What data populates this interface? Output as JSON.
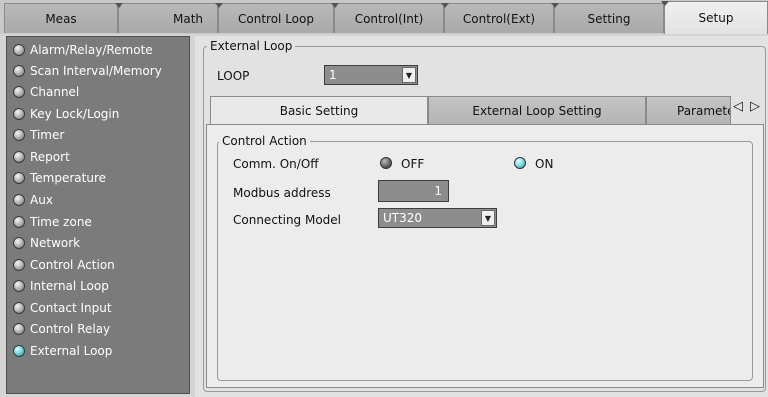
{
  "top_tabs": [
    {
      "label": "Meas"
    },
    {
      "label": "Math"
    },
    {
      "label": "Control Loop"
    },
    {
      "label": "Control(Int)"
    },
    {
      "label": "Control(Ext)"
    },
    {
      "label": "Setting"
    },
    {
      "label": "Setup"
    }
  ],
  "active_top_tab": "Setup",
  "sidebar": {
    "items": [
      {
        "label": "Alarm/Relay/Remote"
      },
      {
        "label": "Scan Interval/Memory"
      },
      {
        "label": "Channel"
      },
      {
        "label": "Key Lock/Login"
      },
      {
        "label": "Timer"
      },
      {
        "label": "Report"
      },
      {
        "label": "Temperature"
      },
      {
        "label": "Aux"
      },
      {
        "label": "Time zone"
      },
      {
        "label": "Network"
      },
      {
        "label": "Control Action"
      },
      {
        "label": "Internal Loop"
      },
      {
        "label": "Contact Input"
      },
      {
        "label": "Control Relay"
      },
      {
        "label": "External Loop"
      }
    ],
    "active_item": "External Loop"
  },
  "main": {
    "group_title": "External Loop",
    "loop_label": "LOOP",
    "loop_value": "1",
    "tabs": [
      {
        "label": "Basic Setting"
      },
      {
        "label": "External Loop Setting"
      },
      {
        "label": "Paramete"
      }
    ],
    "active_tab": "Basic Setting",
    "scroll_left_icon": "◁",
    "scroll_right_icon": "▷",
    "control_action": {
      "title": "Control Action",
      "comm_label": "Comm. On/Off",
      "off_label": "OFF",
      "on_label": "ON",
      "selected": "ON",
      "modbus_label": "Modbus address",
      "modbus_value": "1",
      "model_label": "Connecting Model",
      "model_value": "UT320"
    }
  },
  "colors": {
    "sidebar_bg": "#7b7b7b",
    "active_led": "#7fe0ea",
    "field_bg": "#8d8d8d"
  }
}
